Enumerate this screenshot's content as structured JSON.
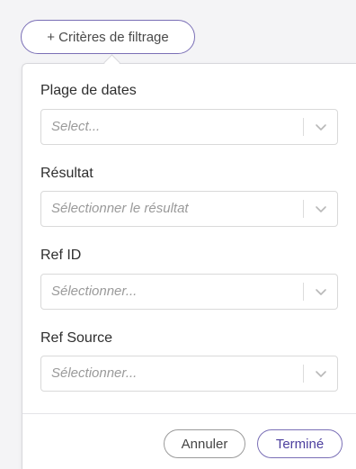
{
  "filter_toggle": {
    "label": "+ Critères de filtrage"
  },
  "fields": [
    {
      "label": "Plage de dates",
      "placeholder": "Select...",
      "icon": "chevron-down-icon"
    },
    {
      "label": "Résultat",
      "placeholder": "Sélectionner le résultat",
      "icon": "chevron-down-icon"
    },
    {
      "label": "Ref ID",
      "placeholder": "Sélectionner...",
      "icon": "chevron-down-icon"
    },
    {
      "label": "Ref Source",
      "placeholder": "Sélectionner...",
      "icon": "chevron-down-icon"
    }
  ],
  "actions": {
    "cancel_label": "Annuler",
    "done_label": "Terminé"
  },
  "colors": {
    "accent": "#7a6fb6",
    "accent_text": "#4c3f9e",
    "border": "#d9d9d9",
    "placeholder": "#9a9a9a"
  }
}
